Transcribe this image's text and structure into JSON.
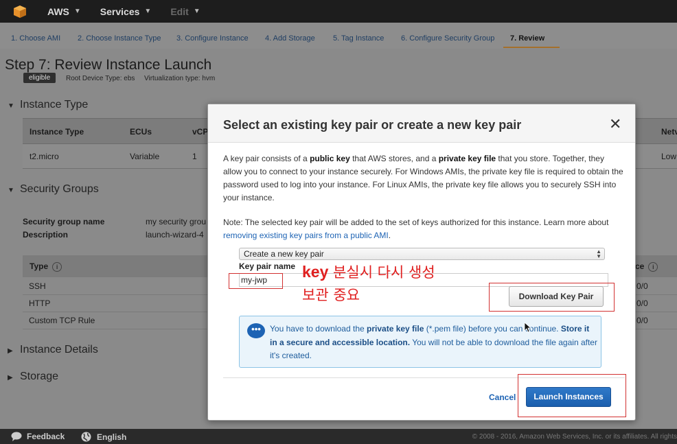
{
  "topnav": {
    "brand": "AWS",
    "services": "Services",
    "edit": "Edit"
  },
  "steps": [
    "1. Choose AMI",
    "2. Choose Instance Type",
    "3. Configure Instance",
    "4. Add Storage",
    "5. Tag Instance",
    "6. Configure Security Group",
    "7. Review"
  ],
  "page": {
    "title": "Step 7: Review Instance Launch",
    "badge": "eligible",
    "root_device": "Root Device Type: ebs",
    "virtualization": "Virtualization type: hvm",
    "instance_type_section": "Instance Type",
    "instance_table": {
      "headers": [
        "Instance Type",
        "ECUs",
        "vCP",
        "Netv"
      ],
      "row": [
        "t2.micro",
        "Variable",
        "1",
        "Low"
      ]
    },
    "security_section": "Security Groups",
    "sg_name_label": "Security group name",
    "sg_name_value": "my security grou",
    "sg_desc_label": "Description",
    "sg_desc_value": "launch-wizard-4",
    "sg_table": {
      "type_header": "Type",
      "source_header": "ce",
      "rows": [
        {
          "type": "SSH",
          "source": "0/0"
        },
        {
          "type": "HTTP",
          "source": "0/0"
        },
        {
          "type": "Custom TCP Rule",
          "source": "0/0"
        }
      ]
    },
    "instance_details_section": "Instance Details",
    "storage_section": "Storage"
  },
  "footer": {
    "feedback": "Feedback",
    "language": "English",
    "copyright": "© 2008 - 2016, Amazon Web Services, Inc. or its affiliates. All rights"
  },
  "modal": {
    "title": "Select an existing key pair or create a new key pair",
    "desc_1": "A key pair consists of a ",
    "desc_2": "public key",
    "desc_3": " that AWS stores, and a ",
    "desc_4": "private key file",
    "desc_5": " that you store. Together, they allow you to connect to your instance securely. For Windows AMIs, the private key file is required to obtain the password used to log into your instance. For Linux AMIs, the private key file allows you to securely SSH into your instance.",
    "note_text": "Note: The selected key pair will be added to the set of keys authorized for this instance. Learn more about ",
    "note_link": "removing existing key pairs from a public AMI",
    "note_end": ".",
    "select_value": "Create a new key pair",
    "key_pair_label": "Key pair name",
    "key_pair_value": "my-jwp",
    "download_button": "Download Key Pair",
    "alert_1": "You have to download the ",
    "alert_2": "private key file",
    "alert_3": " (*.pem file) before you can continue. ",
    "alert_4": "Store it in a secure and accessible location.",
    "alert_5": " You will not be able to download the file again after it's created.",
    "cancel_button": "Cancel",
    "launch_button": "Launch Instances"
  },
  "annotation": {
    "line1_key": "key",
    "line1_rest": " 분실시 다시 생성",
    "line2": "보관 중요",
    "color": "#e02020"
  }
}
